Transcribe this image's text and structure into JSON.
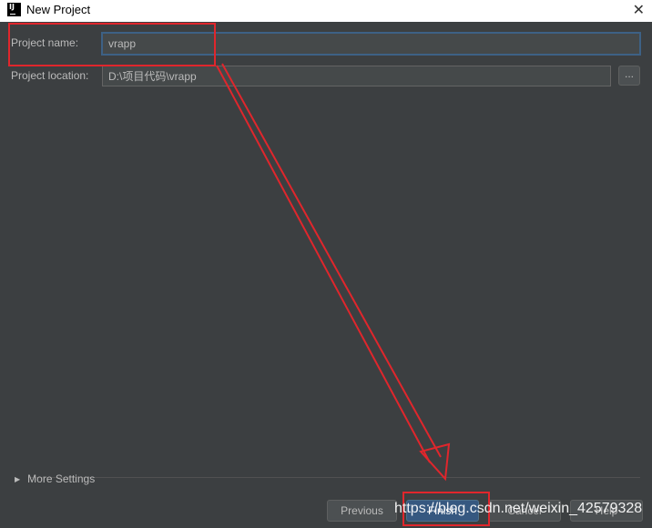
{
  "window": {
    "title": "New Project",
    "icon_text": "IJ",
    "close_glyph": "✕"
  },
  "form": {
    "project_name_label": "Project name:",
    "project_name_value": "vrapp",
    "project_location_label": "Project location:",
    "project_location_value": "D:\\项目代码\\vrapp",
    "browse_label": "..."
  },
  "more_settings": {
    "label": "More Settings",
    "expanded": false
  },
  "buttons": {
    "previous": "Previous",
    "finish": "Finish",
    "cancel": "Cancel",
    "help": "Help"
  },
  "annotation": {
    "highlight_color": "#e0262c",
    "watermark": "https://blog.csdn.net/weixin_42579328"
  },
  "colors": {
    "background": "#3c3f41",
    "field_background": "#45494a",
    "focus_border": "#3d6185",
    "primary_button": "#365880"
  }
}
